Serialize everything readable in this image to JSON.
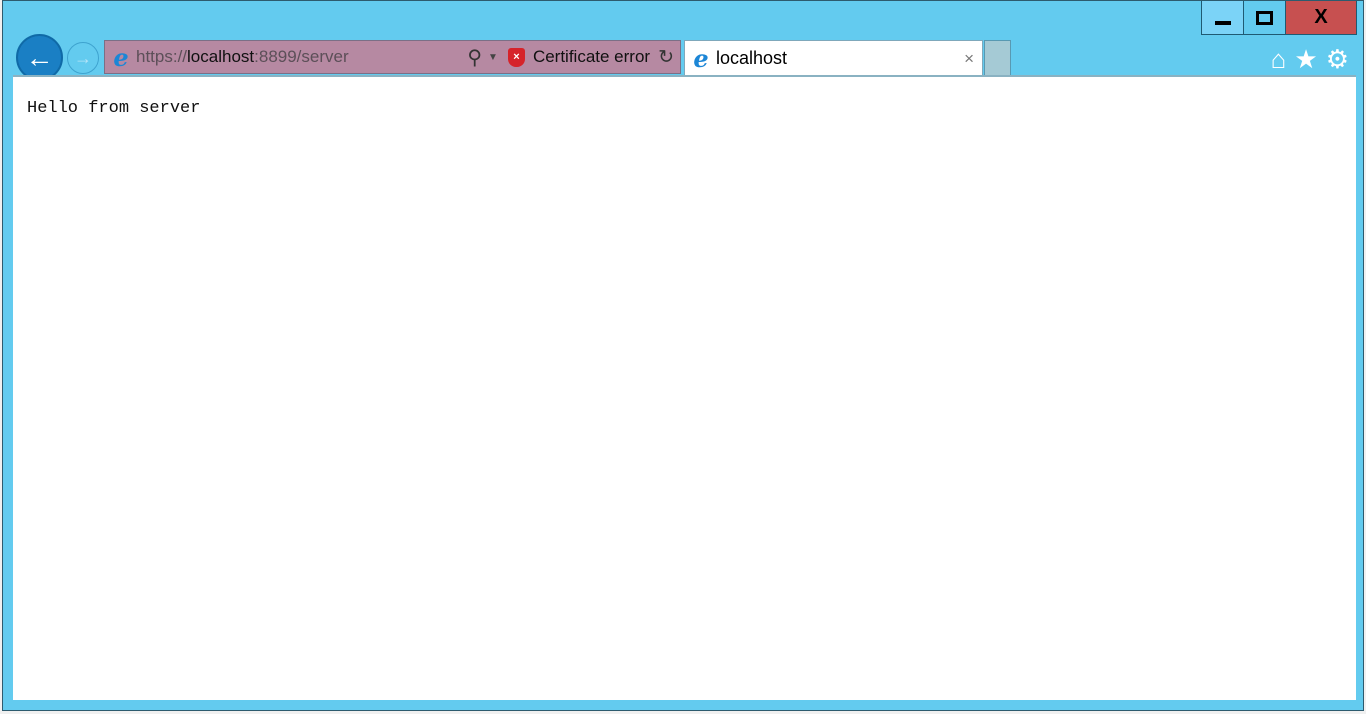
{
  "window": {
    "minimize_label": "—",
    "maximize_label": "☐",
    "close_label": "X"
  },
  "address_bar": {
    "scheme": "https://",
    "host": "localhost",
    "rest": ":8899/server",
    "certificate_error": "Certificate error",
    "shield_glyph": "×"
  },
  "tab": {
    "title": "localhost",
    "close_label": "×"
  },
  "page": {
    "text": "Hello from server"
  },
  "icons": {
    "back": "←",
    "forward": "→",
    "ie": "e",
    "search": "⚲",
    "dropdown": "▼",
    "refresh": "↻",
    "home": "⌂",
    "star": "★",
    "gear": "⚙"
  }
}
